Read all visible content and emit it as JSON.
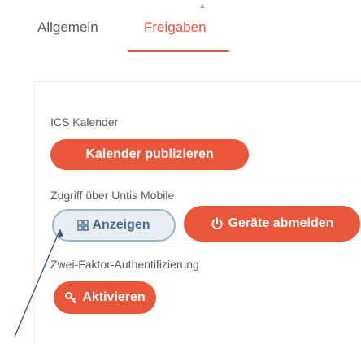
{
  "tabs": [
    {
      "label": "Allgemein",
      "active": false
    },
    {
      "label": "Freigaben",
      "active": true
    }
  ],
  "sections": {
    "ics": {
      "label": "ICS Kalender",
      "button_label": "Kalender publizieren"
    },
    "untis": {
      "label": "Zugriff über Untis Mobile",
      "show_button_label": "Anzeigen",
      "logout_button_label": "Geräte abmelden"
    },
    "twofa": {
      "label": "Zwei-Faktor-Authentifizierung",
      "button_label": "Aktivieren"
    }
  },
  "colors": {
    "accent": "#e9573b",
    "text": "#555b66",
    "outline": "#9fb3c8"
  },
  "icons": {
    "show": "qr-icon",
    "logout": "power-icon",
    "activate": "key-icon"
  }
}
